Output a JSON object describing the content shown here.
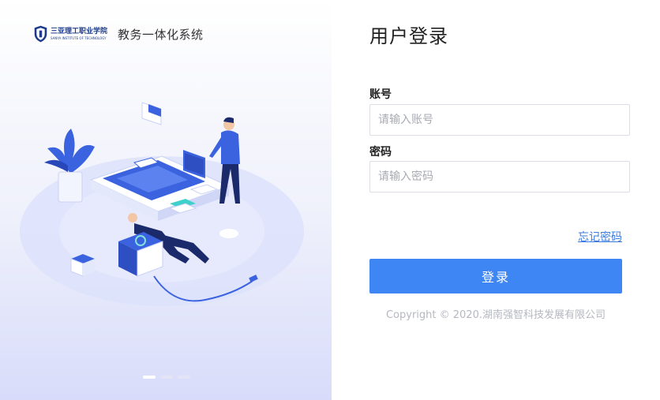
{
  "brand": {
    "logo_cn": "三亚理工职业学院",
    "logo_en": "SANYA INSTITUTE OF TECHNOLOGY",
    "system_name": "教务一体化系统"
  },
  "carousel": {
    "count": 3,
    "active_index": 0
  },
  "login": {
    "title": "用户登录",
    "account_label": "账号",
    "account_placeholder": "请输入账号",
    "password_label": "密码",
    "password_placeholder": "请输入密码",
    "forgot_label": "忘记密码",
    "submit_label": "登录"
  },
  "footer": {
    "copyright": "Copyright © 2020.湖南强智科技发展有限公司"
  },
  "colors": {
    "primary": "#3f86f5",
    "link": "#3a7be0",
    "illustration_blue": "#3b63e0"
  }
}
